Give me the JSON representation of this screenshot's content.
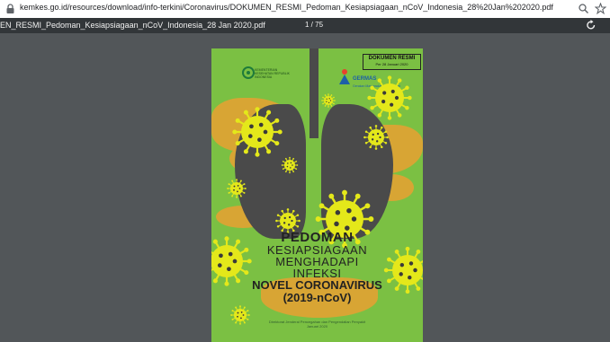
{
  "browser": {
    "url": "kemkes.go.id/resources/download/info-terkini/Coronavirus/DOKUMEN_RESMI_Pedoman_Kesiapsiagaan_nCoV_Indonesia_28%20Jan%202020.pdf"
  },
  "pdf_toolbar": {
    "filename": "EN_RESMI_Pedoman_Kesiapsiagaan_nCoV_Indonesia_28 Jan 2020.pdf",
    "page_indicator": "1 / 75"
  },
  "cover": {
    "badge_title": "DOKUMEN RESMI",
    "badge_date": "Per 28 Januari 2020",
    "ministry": "KEMENTERIAN KESEHATAN REPUBLIK INDONESIA",
    "germas": "GERMAS",
    "germas_sub": "Gerakan Masyarakat Hidup Sehat",
    "title_line1": "PEDOMAN",
    "title_line2": "KESIAPSIAGAAN",
    "title_line3": "MENGHADAPI",
    "title_line4": "INFEKSI",
    "title_line5": "NOVEL CORONAVIRUS",
    "title_line6": "(2019-nCoV)",
    "footer_line1": "Direktorat Jenderal Pencegahan dan Pengendalian Penyakit",
    "footer_line2": "Januari 2020"
  },
  "colors": {
    "cover_green": "#7bc043",
    "virus_yellow": "#e4e81a",
    "lung_gray": "#4a4a4a",
    "orange": "#e2a233"
  }
}
